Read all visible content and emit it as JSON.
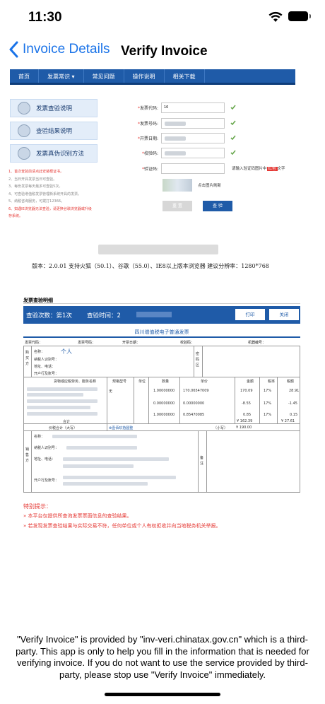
{
  "status": {
    "time": "11:30"
  },
  "nav": {
    "back_label": "Invoice Details",
    "title": "Verify Invoice"
  },
  "site": {
    "menu": [
      "首页",
      "发票常识 ▾",
      "常见问题",
      "操作说明",
      "相关下载"
    ],
    "side_buttons": [
      "发票查验说明",
      "查验结果说明",
      "发票真伪识别方法"
    ],
    "notes": [
      "1、首次查验前请点此安装根证书。",
      "2、当日开具发票当日可查验。",
      "3、每份发票每天最多可查验5次。",
      "4、可查验增值税发票管理新系统开具的发票。",
      "5、纳税咨询服务，可拨打12366。",
      "6、如遇IE浏览器无法查验，请更换谷歌浏览器或升级",
      "存系统。"
    ],
    "form": {
      "code_label": "发票代码:",
      "number_label": "发票号码:",
      "date_label": "开票日期:",
      "check_label": "校验码:",
      "captcha_label": "验证码:",
      "code_prefix": "10",
      "captcha_hint_pre": "请输入验证码图片中",
      "captcha_hint_em": "红色",
      "captcha_hint_post": "文字",
      "captcha_refresh": "点击图片刷新",
      "reset_label": "重 置",
      "check_button": "查 验"
    },
    "version": "版本：2.0.01   支持火狐（50.1）、谷歌（55.0）、IE8以上版本浏览器   建议分辨率：1280*768"
  },
  "invoice": {
    "section_title": "发票查验明细",
    "count_label": "查验次数：第1次",
    "time_label": "查验时间：2",
    "print_label": "打印",
    "close_label": "关闭",
    "subtitle": "四川增值税电子普通发票",
    "meta": [
      "发票代码：",
      "发票号码：",
      "开票日期：",
      "校验码：",
      "机器编号："
    ],
    "buyer_side": [
      "购",
      "买",
      "方"
    ],
    "buyer_fields": [
      "名称：",
      "纳税人识别号：",
      "地址、电话：",
      "开户行及账号："
    ],
    "buyer_name": "个人",
    "pwd_area": [
      "密",
      "码",
      "区"
    ],
    "columns": [
      "货物或应税劳务、服务名称",
      "规格型号",
      "单位",
      "数量",
      "单价",
      "金额",
      "税率",
      "税额"
    ],
    "rows": [
      {
        "spec": "无",
        "qty": "1.00000000",
        "price": "170.06547009",
        "amount": "170.09",
        "rate": "17%",
        "tax": "28.91"
      },
      {
        "spec": "",
        "qty": "0.00000000",
        "price": "0.00000000",
        "amount": "-8.55",
        "rate": "17%",
        "tax": "-1.45"
      },
      {
        "spec": "",
        "qty": "1.00000000",
        "price": "0.85470085",
        "amount": "0.85",
        "rate": "17%",
        "tax": "0.15"
      }
    ],
    "total_label": "合计",
    "total_amount": "¥ 162.39",
    "total_tax": "¥ 27.61",
    "sum_label": "价税合计（大写）",
    "sum_upper": "⊗壹佰玖拾圆整",
    "sum_small": "（小写）",
    "sum_value": "¥ 190.00",
    "seller_side": [
      "销",
      "售",
      "方"
    ],
    "seller_fields": [
      "名称：",
      "纳税人识别号：",
      "地址、电话：",
      "开户行及账号："
    ],
    "remark": [
      "备",
      "注"
    ],
    "special_title": "特别提示：",
    "special_items": [
      "»  本平台仅提供所查询发票票面信息的查验结果。",
      "»  若发现发票查验结果与实际交易不符，任何单位或个人有权拒收并向当地税务机关举报。"
    ]
  },
  "disclaimer": "\"Verify Invoice\" is provided by \"inv-veri.chinatax.gov.cn\" which is a third-party. This app is only to help you fill in the information that is needed for verifying invoice. If you do not want to use the service provided by third-party, please stop use \"Verify Invoice\" immediately."
}
